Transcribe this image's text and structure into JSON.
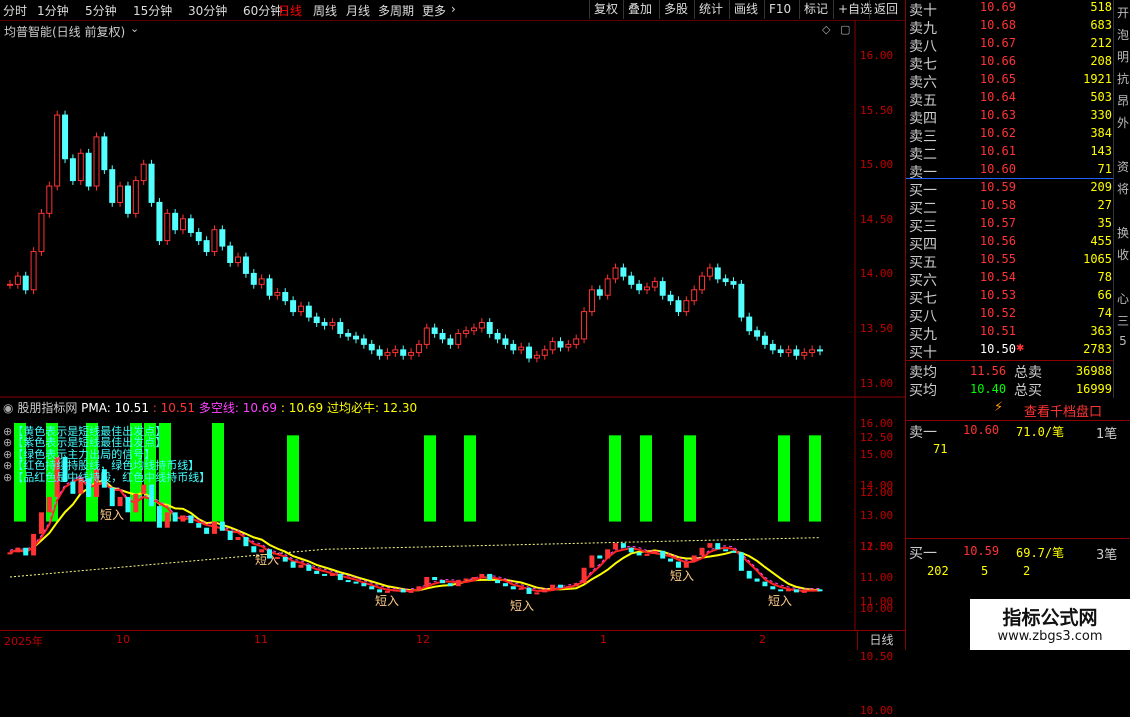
{
  "toolbar": {
    "periods": [
      "分时",
      "1分钟",
      "5分钟",
      "15分钟",
      "30分钟",
      "60分钟",
      "日线",
      "周线",
      "月线",
      "多周期",
      "更多"
    ],
    "active_period": "日线",
    "buttons": [
      "复权",
      "叠加",
      "多股",
      "统计",
      "画线",
      "F10",
      "标记",
      "+自选",
      "返回"
    ]
  },
  "main_chart": {
    "title": "均普智能(日线 前复权)",
    "price_scale": [
      "16.00",
      "15.50",
      "15.00",
      "14.50",
      "14.00",
      "13.50",
      "13.00",
      "12.50",
      "12.00",
      "11.50",
      "11.00",
      "10.50",
      "10.00"
    ]
  },
  "sub_chart": {
    "indicator_name": "股朋指标网",
    "pma_label": "PMA: 10.51",
    "val_red": ": 10.51",
    "duokong_label": "多空线: 10.69",
    "val3": ": 10.69",
    "guojun_label": "过均必牛: 12.30",
    "price_scale": [
      "16.00",
      "15.00",
      "14.00",
      "13.00",
      "12.00",
      "11.00",
      "10.00"
    ],
    "legend": [
      "【黄色表示是短线最佳出发点】",
      "【紫色表示是短线最佳出发点】",
      "【绿色表示主力出局的信号】",
      "【红色持续持股线，绿色均线持币线】",
      "【品红色是中线持股，红色中线持币线】"
    ],
    "signal_label": "短入"
  },
  "time_axis": [
    "2025年",
    "10",
    "11",
    "12",
    "1",
    "2"
  ],
  "period_badge": "日线",
  "orderbook": {
    "sell": [
      {
        "label": "卖十",
        "price": "10.69",
        "vol": "518"
      },
      {
        "label": "卖九",
        "price": "10.68",
        "vol": "683"
      },
      {
        "label": "卖八",
        "price": "10.67",
        "vol": "212"
      },
      {
        "label": "卖七",
        "price": "10.66",
        "vol": "208"
      },
      {
        "label": "卖六",
        "price": "10.65",
        "vol": "1921"
      },
      {
        "label": "卖五",
        "price": "10.64",
        "vol": "503"
      },
      {
        "label": "卖四",
        "price": "10.63",
        "vol": "330"
      },
      {
        "label": "卖三",
        "price": "10.62",
        "vol": "384"
      },
      {
        "label": "卖二",
        "price": "10.61",
        "vol": "143"
      },
      {
        "label": "卖一",
        "price": "10.60",
        "vol": "71"
      }
    ],
    "buy": [
      {
        "label": "买一",
        "price": "10.59",
        "vol": "209"
      },
      {
        "label": "买二",
        "price": "10.58",
        "vol": "27"
      },
      {
        "label": "买三",
        "price": "10.57",
        "vol": "35"
      },
      {
        "label": "买四",
        "price": "10.56",
        "vol": "455"
      },
      {
        "label": "买五",
        "price": "10.55",
        "vol": "1065"
      },
      {
        "label": "买六",
        "price": "10.54",
        "vol": "78"
      },
      {
        "label": "买七",
        "price": "10.53",
        "vol": "66"
      },
      {
        "label": "买八",
        "price": "10.52",
        "vol": "74"
      },
      {
        "label": "买九",
        "price": "10.51",
        "vol": "363"
      },
      {
        "label": "买十",
        "price": "10.50",
        "vol": "2783"
      }
    ],
    "avg_sell_label": "卖均",
    "avg_sell_price": "11.56",
    "total_sell_label": "总卖",
    "total_sell": "36988",
    "avg_buy_label": "买均",
    "avg_buy_price": "10.40",
    "total_buy_label": "总买",
    "total_buy": "16999"
  },
  "side_strip": [
    "开",
    "泡",
    "明",
    "抗",
    "昂",
    "外",
    "",
    "资",
    "将",
    "",
    "换",
    "收",
    "",
    "心",
    "三",
    "5"
  ],
  "tick_panel": {
    "button": "查看千档盘口",
    "sell1_label": "卖一",
    "sell1_price": "10.60",
    "sell1_avg": "71.0/笔",
    "sell1_count": "1笔",
    "sell1_detail": "71",
    "buy1_label": "买一",
    "buy1_price": "10.59",
    "buy1_avg": "69.7/笔",
    "buy1_count": "3笔",
    "buy1_detail": [
      "202",
      "5",
      "2"
    ]
  },
  "watermark": {
    "title": "指标公式网",
    "url": "www.zbgs3.com"
  },
  "colors": {
    "up": "#ff3333",
    "down": "#54ffff",
    "axis": "#c00000",
    "green": "#00ff00",
    "yellow": "#ffff00",
    "magenta": "#ff44ff"
  }
}
